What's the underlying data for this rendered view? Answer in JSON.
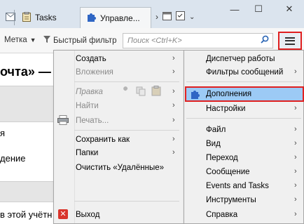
{
  "tabs": [
    {
      "label": "",
      "icon": "envelope-icon"
    },
    {
      "label": "Tasks",
      "icon": "clipboard-icon"
    },
    {
      "label": "Управле...",
      "icon": "puzzle-icon"
    }
  ],
  "window_controls": {
    "minimize": "—",
    "maximize": "☐",
    "close": "✕"
  },
  "toolbar": {
    "tag_label": "Метка",
    "quick_filter_label": "Быстрый фильтр",
    "search_placeholder": "Поиск <Ctrl+K>"
  },
  "background": {
    "title": "очта» —",
    "line1": "я",
    "line2": "дение",
    "footer": "в этой учётн"
  },
  "left_menu": {
    "items": [
      {
        "label": "Создать",
        "disabled": false,
        "submenu": true
      },
      {
        "label": "Вложения",
        "disabled": true,
        "submenu": true
      },
      {
        "label": "Правка",
        "disabled": true,
        "submenu": true,
        "italic": true
      },
      {
        "label": "Найти",
        "disabled": true,
        "submenu": true
      },
      {
        "label": "Печать...",
        "disabled": true,
        "submenu": true
      },
      {
        "label": "Сохранить как",
        "disabled": false,
        "submenu": true
      },
      {
        "label": "Папки",
        "disabled": false,
        "submenu": true
      },
      {
        "label": "Очистить «Удалённые»",
        "disabled": false,
        "submenu": false
      },
      {
        "label": "Выход",
        "disabled": false,
        "submenu": false
      }
    ]
  },
  "right_menu": {
    "items": [
      {
        "label": "Диспетчер работы",
        "submenu": false
      },
      {
        "label": "Фильтры сообщений",
        "submenu": true
      },
      {
        "label": "Дополнения",
        "submenu": false,
        "highlighted": true
      },
      {
        "label": "Настройки",
        "submenu": true
      },
      {
        "label": "Файл",
        "submenu": true
      },
      {
        "label": "Вид",
        "submenu": true
      },
      {
        "label": "Переход",
        "submenu": true
      },
      {
        "label": "Сообщение",
        "submenu": true
      },
      {
        "label": "Events and Tasks",
        "submenu": true
      },
      {
        "label": "Инструменты",
        "submenu": true
      },
      {
        "label": "Справка",
        "submenu": true
      }
    ]
  },
  "colors": {
    "highlight": "#9ccaf5",
    "annotation_red": "#e02020",
    "accent_blue": "#2a65b5"
  }
}
